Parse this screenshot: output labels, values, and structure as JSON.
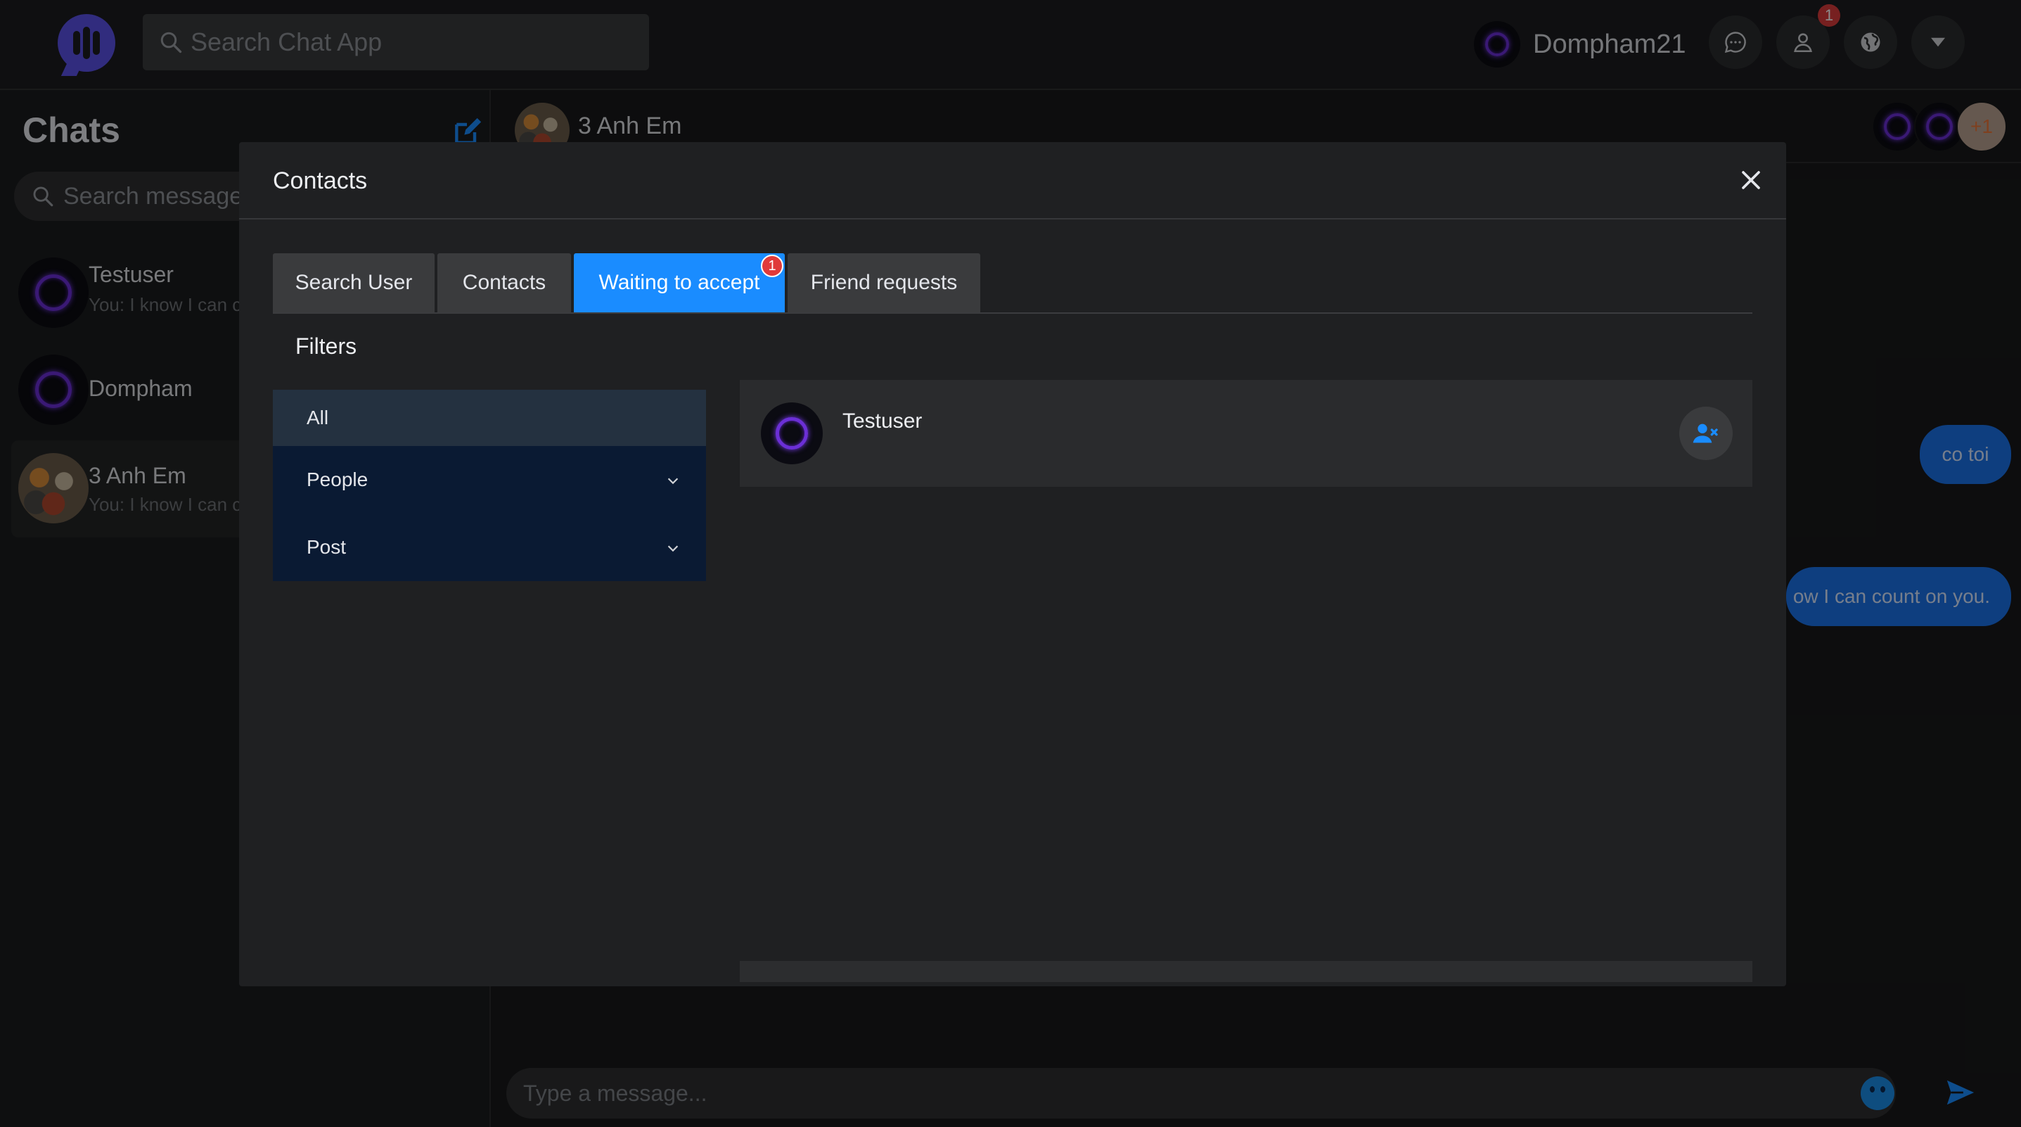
{
  "app": {
    "search_placeholder": "Search Chat App",
    "user_name": "Dompham21",
    "notification_count": "1"
  },
  "sidebar": {
    "title": "Chats",
    "search_placeholder": "Search messages",
    "chats": [
      {
        "name": "Testuser",
        "preview": "You: I know I can count on you."
      },
      {
        "name": "Dompham",
        "preview": ""
      },
      {
        "name": "3 Anh Em",
        "preview": "You: I know I can count on you."
      }
    ]
  },
  "conversation": {
    "name": "3 Anh Em",
    "extra_members": "+1",
    "messages": [
      {
        "text": "co toi"
      },
      {
        "text": "ow I can count on you."
      }
    ],
    "composer_placeholder": "Type a message..."
  },
  "modal": {
    "title": "Contacts",
    "tabs": [
      {
        "label": "Search User"
      },
      {
        "label": "Contacts"
      },
      {
        "label": "Waiting to accept",
        "badge": "1"
      },
      {
        "label": "Friend requests"
      }
    ],
    "active_tab": "Waiting to accept",
    "filters_title": "Filters",
    "filters": [
      {
        "label": "All"
      },
      {
        "label": "People"
      },
      {
        "label": "Post"
      }
    ],
    "results": [
      {
        "name": "Testuser"
      }
    ]
  },
  "colors": {
    "accent": "#1a8cff",
    "background": "#18191a",
    "bubble": "#1b72e8",
    "badge": "#e03a3a"
  }
}
